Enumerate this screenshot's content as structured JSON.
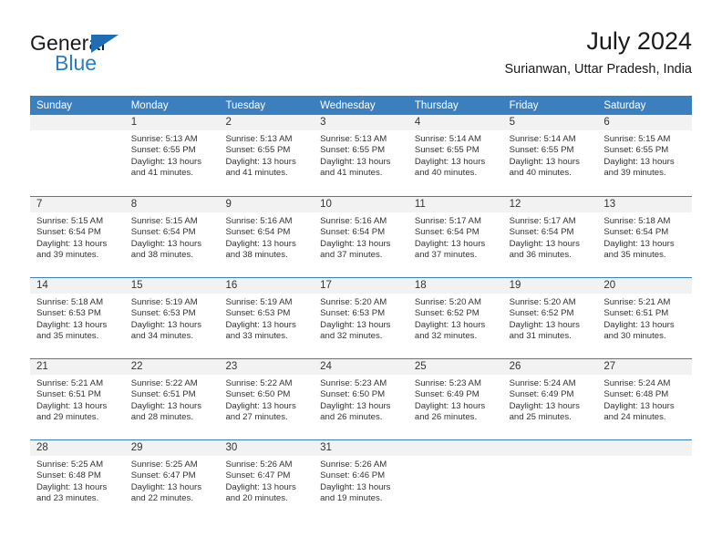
{
  "brand": {
    "name_primary": "General",
    "name_secondary": "Blue",
    "accent_color": "#2a7ec0",
    "triangle_color": "#1f6eb5"
  },
  "header": {
    "title": "July 2024",
    "subtitle": "Surianwan, Uttar Pradesh, India"
  },
  "theme": {
    "header_row_bg": "#3c7fbf",
    "daynum_band_bg": "#f2f2f2",
    "row_separator": "#3c7fbf",
    "text": "#333333"
  },
  "weekdays": [
    "Sunday",
    "Monday",
    "Tuesday",
    "Wednesday",
    "Thursday",
    "Friday",
    "Saturday"
  ],
  "labels": {
    "sunrise": "Sunrise:",
    "sunset": "Sunset:",
    "daylight": "Daylight:"
  },
  "weeks": [
    [
      {
        "day": ""
      },
      {
        "day": "1",
        "sunrise": "Sunrise: 5:13 AM",
        "sunset": "Sunset: 6:55 PM",
        "daylight_line1": "Daylight: 13 hours",
        "daylight_line2": "and 41 minutes."
      },
      {
        "day": "2",
        "sunrise": "Sunrise: 5:13 AM",
        "sunset": "Sunset: 6:55 PM",
        "daylight_line1": "Daylight: 13 hours",
        "daylight_line2": "and 41 minutes."
      },
      {
        "day": "3",
        "sunrise": "Sunrise: 5:13 AM",
        "sunset": "Sunset: 6:55 PM",
        "daylight_line1": "Daylight: 13 hours",
        "daylight_line2": "and 41 minutes."
      },
      {
        "day": "4",
        "sunrise": "Sunrise: 5:14 AM",
        "sunset": "Sunset: 6:55 PM",
        "daylight_line1": "Daylight: 13 hours",
        "daylight_line2": "and 40 minutes."
      },
      {
        "day": "5",
        "sunrise": "Sunrise: 5:14 AM",
        "sunset": "Sunset: 6:55 PM",
        "daylight_line1": "Daylight: 13 hours",
        "daylight_line2": "and 40 minutes."
      },
      {
        "day": "6",
        "sunrise": "Sunrise: 5:15 AM",
        "sunset": "Sunset: 6:55 PM",
        "daylight_line1": "Daylight: 13 hours",
        "daylight_line2": "and 39 minutes."
      }
    ],
    [
      {
        "day": "7",
        "sunrise": "Sunrise: 5:15 AM",
        "sunset": "Sunset: 6:54 PM",
        "daylight_line1": "Daylight: 13 hours",
        "daylight_line2": "and 39 minutes."
      },
      {
        "day": "8",
        "sunrise": "Sunrise: 5:15 AM",
        "sunset": "Sunset: 6:54 PM",
        "daylight_line1": "Daylight: 13 hours",
        "daylight_line2": "and 38 minutes."
      },
      {
        "day": "9",
        "sunrise": "Sunrise: 5:16 AM",
        "sunset": "Sunset: 6:54 PM",
        "daylight_line1": "Daylight: 13 hours",
        "daylight_line2": "and 38 minutes."
      },
      {
        "day": "10",
        "sunrise": "Sunrise: 5:16 AM",
        "sunset": "Sunset: 6:54 PM",
        "daylight_line1": "Daylight: 13 hours",
        "daylight_line2": "and 37 minutes."
      },
      {
        "day": "11",
        "sunrise": "Sunrise: 5:17 AM",
        "sunset": "Sunset: 6:54 PM",
        "daylight_line1": "Daylight: 13 hours",
        "daylight_line2": "and 37 minutes."
      },
      {
        "day": "12",
        "sunrise": "Sunrise: 5:17 AM",
        "sunset": "Sunset: 6:54 PM",
        "daylight_line1": "Daylight: 13 hours",
        "daylight_line2": "and 36 minutes."
      },
      {
        "day": "13",
        "sunrise": "Sunrise: 5:18 AM",
        "sunset": "Sunset: 6:54 PM",
        "daylight_line1": "Daylight: 13 hours",
        "daylight_line2": "and 35 minutes."
      }
    ],
    [
      {
        "day": "14",
        "sunrise": "Sunrise: 5:18 AM",
        "sunset": "Sunset: 6:53 PM",
        "daylight_line1": "Daylight: 13 hours",
        "daylight_line2": "and 35 minutes."
      },
      {
        "day": "15",
        "sunrise": "Sunrise: 5:19 AM",
        "sunset": "Sunset: 6:53 PM",
        "daylight_line1": "Daylight: 13 hours",
        "daylight_line2": "and 34 minutes."
      },
      {
        "day": "16",
        "sunrise": "Sunrise: 5:19 AM",
        "sunset": "Sunset: 6:53 PM",
        "daylight_line1": "Daylight: 13 hours",
        "daylight_line2": "and 33 minutes."
      },
      {
        "day": "17",
        "sunrise": "Sunrise: 5:20 AM",
        "sunset": "Sunset: 6:53 PM",
        "daylight_line1": "Daylight: 13 hours",
        "daylight_line2": "and 32 minutes."
      },
      {
        "day": "18",
        "sunrise": "Sunrise: 5:20 AM",
        "sunset": "Sunset: 6:52 PM",
        "daylight_line1": "Daylight: 13 hours",
        "daylight_line2": "and 32 minutes."
      },
      {
        "day": "19",
        "sunrise": "Sunrise: 5:20 AM",
        "sunset": "Sunset: 6:52 PM",
        "daylight_line1": "Daylight: 13 hours",
        "daylight_line2": "and 31 minutes."
      },
      {
        "day": "20",
        "sunrise": "Sunrise: 5:21 AM",
        "sunset": "Sunset: 6:51 PM",
        "daylight_line1": "Daylight: 13 hours",
        "daylight_line2": "and 30 minutes."
      }
    ],
    [
      {
        "day": "21",
        "sunrise": "Sunrise: 5:21 AM",
        "sunset": "Sunset: 6:51 PM",
        "daylight_line1": "Daylight: 13 hours",
        "daylight_line2": "and 29 minutes."
      },
      {
        "day": "22",
        "sunrise": "Sunrise: 5:22 AM",
        "sunset": "Sunset: 6:51 PM",
        "daylight_line1": "Daylight: 13 hours",
        "daylight_line2": "and 28 minutes."
      },
      {
        "day": "23",
        "sunrise": "Sunrise: 5:22 AM",
        "sunset": "Sunset: 6:50 PM",
        "daylight_line1": "Daylight: 13 hours",
        "daylight_line2": "and 27 minutes."
      },
      {
        "day": "24",
        "sunrise": "Sunrise: 5:23 AM",
        "sunset": "Sunset: 6:50 PM",
        "daylight_line1": "Daylight: 13 hours",
        "daylight_line2": "and 26 minutes."
      },
      {
        "day": "25",
        "sunrise": "Sunrise: 5:23 AM",
        "sunset": "Sunset: 6:49 PM",
        "daylight_line1": "Daylight: 13 hours",
        "daylight_line2": "and 26 minutes."
      },
      {
        "day": "26",
        "sunrise": "Sunrise: 5:24 AM",
        "sunset": "Sunset: 6:49 PM",
        "daylight_line1": "Daylight: 13 hours",
        "daylight_line2": "and 25 minutes."
      },
      {
        "day": "27",
        "sunrise": "Sunrise: 5:24 AM",
        "sunset": "Sunset: 6:48 PM",
        "daylight_line1": "Daylight: 13 hours",
        "daylight_line2": "and 24 minutes."
      }
    ],
    [
      {
        "day": "28",
        "sunrise": "Sunrise: 5:25 AM",
        "sunset": "Sunset: 6:48 PM",
        "daylight_line1": "Daylight: 13 hours",
        "daylight_line2": "and 23 minutes."
      },
      {
        "day": "29",
        "sunrise": "Sunrise: 5:25 AM",
        "sunset": "Sunset: 6:47 PM",
        "daylight_line1": "Daylight: 13 hours",
        "daylight_line2": "and 22 minutes."
      },
      {
        "day": "30",
        "sunrise": "Sunrise: 5:26 AM",
        "sunset": "Sunset: 6:47 PM",
        "daylight_line1": "Daylight: 13 hours",
        "daylight_line2": "and 20 minutes."
      },
      {
        "day": "31",
        "sunrise": "Sunrise: 5:26 AM",
        "sunset": "Sunset: 6:46 PM",
        "daylight_line1": "Daylight: 13 hours",
        "daylight_line2": "and 19 minutes."
      },
      {
        "day": ""
      },
      {
        "day": ""
      },
      {
        "day": ""
      }
    ]
  ]
}
